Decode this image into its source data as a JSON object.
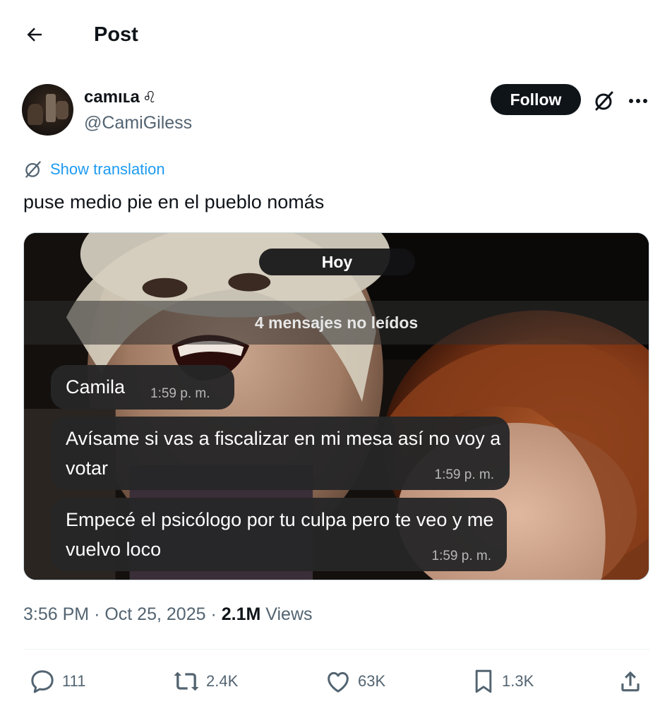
{
  "header": {
    "title": "Post",
    "back_icon": "arrow-left-icon"
  },
  "author": {
    "display_name": "camıʟa",
    "name_glyph": "♌︎",
    "handle": "@CamiGiless"
  },
  "actions_top": {
    "follow_label": "Follow",
    "grok_icon": "grok-icon",
    "more_icon": "more-horizontal-icon"
  },
  "post": {
    "translate_label": "Show translation",
    "text": "puse medio pie en el pueblo nomás"
  },
  "media": {
    "day_pill": "Hoy",
    "unread_banner": "4 mensajes no leídos",
    "messages": [
      {
        "text": "Camila",
        "time": "1:59 p. m."
      },
      {
        "text": "Avísame si vas a fiscalizar en mi mesa así no voy a votar",
        "time": "1:59 p. m."
      },
      {
        "text": "Empecé el psicólogo por tu culpa pero te veo y me vuelvo loco",
        "time": "1:59 p. m."
      }
    ]
  },
  "meta": {
    "time": "3:56 PM",
    "separator": "·",
    "date": "Oct 25, 2025",
    "views_count": "2.1M",
    "views_label": "Views"
  },
  "engagement": {
    "replies": "111",
    "reposts": "2.4K",
    "likes": "63K",
    "bookmarks": "1.3K"
  },
  "colors": {
    "accent": "#1d9bf0",
    "text_primary": "#0f1419",
    "text_secondary": "#536471",
    "follow_bg": "#0f1419"
  }
}
